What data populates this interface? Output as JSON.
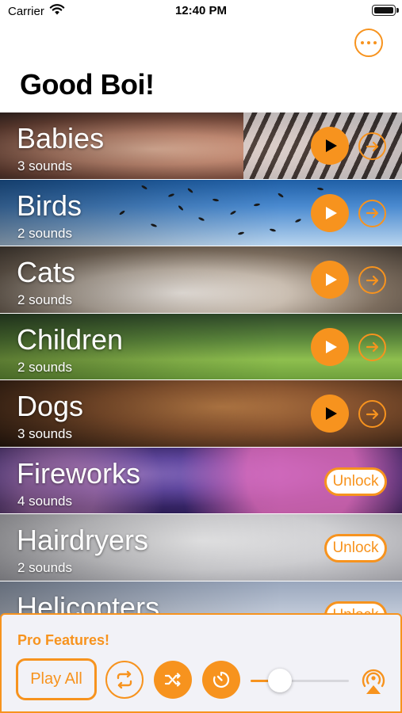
{
  "status_bar": {
    "carrier": "Carrier",
    "time": "12:40 PM"
  },
  "header": {
    "title": "Good Boi!"
  },
  "categories": [
    {
      "title": "Babies",
      "count": "3 sounds",
      "locked": false
    },
    {
      "title": "Birds",
      "count": "2 sounds",
      "locked": false
    },
    {
      "title": "Cats",
      "count": "2 sounds",
      "locked": false
    },
    {
      "title": "Children",
      "count": "2 sounds",
      "locked": false
    },
    {
      "title": "Dogs",
      "count": "3 sounds",
      "locked": false
    },
    {
      "title": "Fireworks",
      "count": "4 sounds",
      "locked": true,
      "unlock_label": "Unlock"
    },
    {
      "title": "Hairdryers",
      "count": "2 sounds",
      "locked": true,
      "unlock_label": "Unlock"
    },
    {
      "title": "Helicopters",
      "count": "",
      "locked": true,
      "unlock_label": "Unlock"
    }
  ],
  "pro_panel": {
    "title": "Pro Features!",
    "play_all_label": "Play All",
    "volume_fraction": 0.27
  },
  "colors": {
    "accent": "#f7931e"
  },
  "icons": [
    "wifi-icon",
    "battery-icon",
    "more-icon",
    "play-icon",
    "arrow-right-circle-icon",
    "repeat-icon",
    "shuffle-icon",
    "timer-icon",
    "airplay-icon"
  ]
}
